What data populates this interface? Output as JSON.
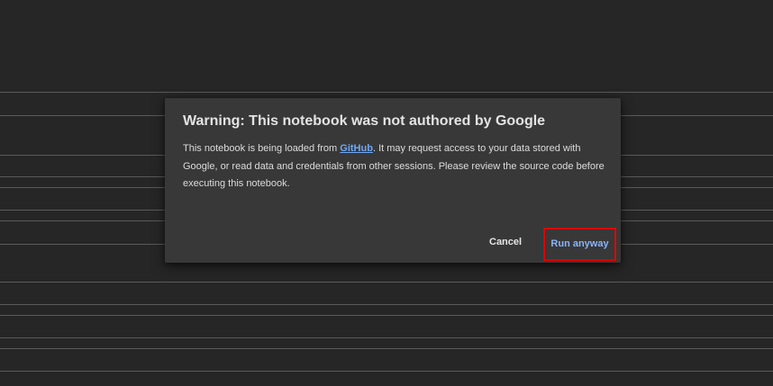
{
  "dialog": {
    "title": "Warning: This notebook was not authored by Google",
    "body_prefix": "This notebook is being loaded from ",
    "body_link": "GitHub",
    "body_suffix": ". It may request access to your data stored with Google, or read data and credentials from other sessions. Please review the source code before executing this notebook.",
    "cancel_label": "Cancel",
    "run_label": "Run anyway"
  },
  "colors": {
    "background": "#262626",
    "dialog_background": "#383838",
    "link": "#6ea8f7",
    "run_button_text": "#8ab4f8",
    "highlight_border": "#e00000"
  }
}
